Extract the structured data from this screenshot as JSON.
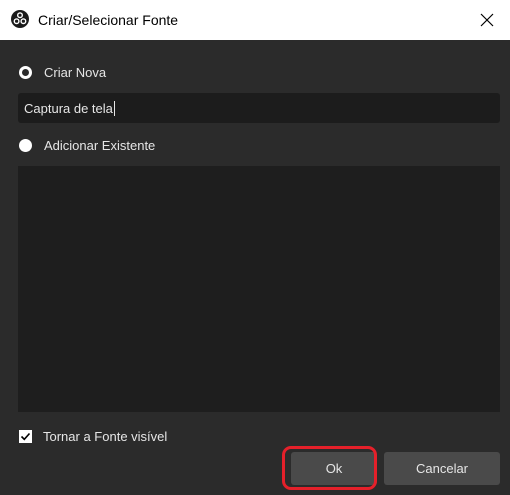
{
  "window": {
    "title": "Criar/Selecionar Fonte",
    "app_icon": "obs-icon",
    "close_icon": "close-icon"
  },
  "options": {
    "create_new_label": "Criar Nova",
    "add_existing_label": "Adicionar Existente",
    "selected": "create_new"
  },
  "name_input": {
    "value": "Captura de tela"
  },
  "visible_checkbox": {
    "label": "Tornar a Fonte visível",
    "checked": true
  },
  "buttons": {
    "ok_label": "Ok",
    "cancel_label": "Cancelar"
  },
  "colors": {
    "background": "#2b2b2b",
    "input_bg": "#1c1c1c",
    "button_bg": "#4a4a4a",
    "highlight": "#e5202a"
  }
}
